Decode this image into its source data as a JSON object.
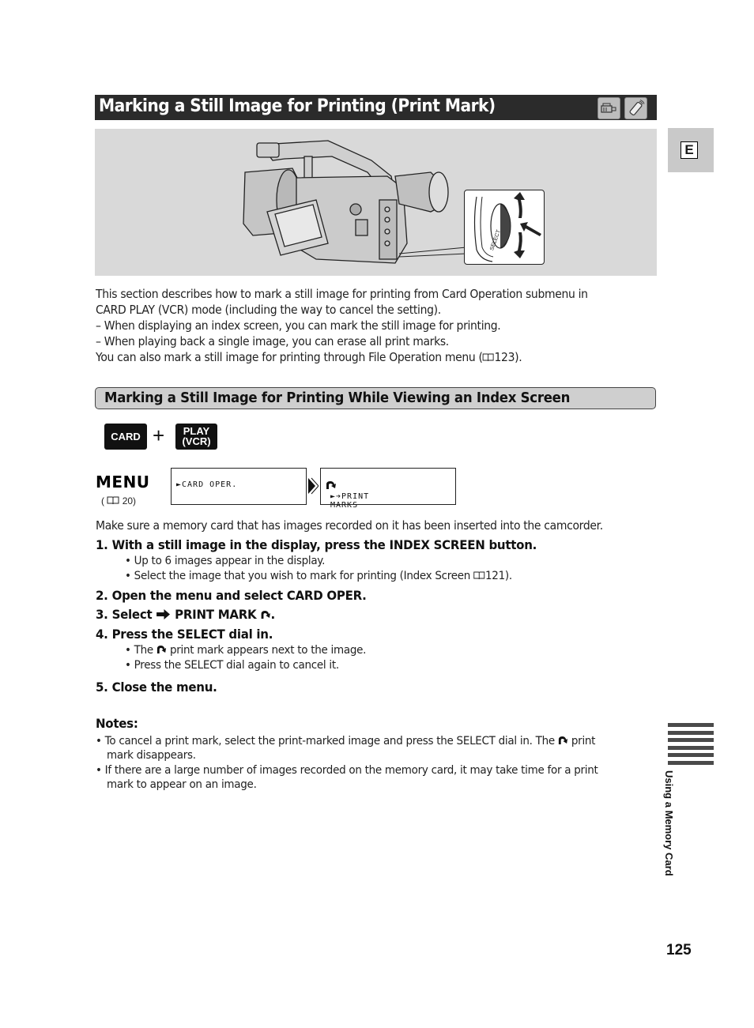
{
  "page": {
    "title": "Marking a Still Image for Printing (Print Mark)",
    "mode_icons": [
      "camcorder-icon",
      "remote-control-icon"
    ],
    "language_tab": "E",
    "illustration": {
      "main": "camcorder-illustration",
      "inset": "select-dial-illustration",
      "inset_label": "SELECT"
    },
    "intro": [
      "This section describes how to mark a still image for printing from Card Operation submenu in",
      "CARD PLAY (VCR) mode (including the way to cancel the setting).",
      "– When displaying an index screen, you can mark the still image for printing.",
      "– When playing back a single image, you can erase all print marks."
    ],
    "intro_ref": {
      "before": "You can also mark a still image for printing through File Operation menu (",
      "page": "123",
      "after": ")."
    },
    "subheading": "Marking a Still Image for Printing While Viewing an Index Screen",
    "mode": {
      "card_label": "CARD",
      "plus": "+",
      "play_line1": "PLAY",
      "play_line2": "(VCR)"
    },
    "menu": {
      "label": "MENU",
      "ref_open": "(",
      "ref_page": "20)",
      "screen1": "►CARD OPER.",
      "screen2": "►➔PRINT MARKS"
    },
    "prereq": "Make sure a memory card that has images recorded on it has been inserted into the camcorder.",
    "steps": [
      {
        "label": "1.  With a still image in the display, press the INDEX SCREEN button.",
        "bullets": [
          "• Up to 6 images appear in the display.",
          "• Select the image that you wish to mark for printing (Index Screen"
        ],
        "ref_page": "121)."
      },
      {
        "label": "2.  Open the menu and select CARD OPER."
      },
      {
        "label_a": "3.  Select",
        "label_b": "PRINT MARK",
        "label_c": "."
      },
      {
        "label": "4.  Press the SELECT dial in.",
        "bullets": [
          "print mark appears next to the image.",
          "• Press the SELECT dial again to cancel it."
        ],
        "bullet_prefix": "• The"
      },
      {
        "label": "5.  Close the menu."
      }
    ],
    "notes": {
      "heading": "Notes:",
      "items": [
        {
          "line1_a": "• To cancel a print mark, select the print-marked image and press the SELECT dial in. The",
          "line1_b": "print",
          "line2": "mark disappears."
        },
        {
          "line1": "• If there are a large number of images recorded on the memory card, it may take time for a print",
          "line2": "mark to appear on an image."
        }
      ]
    },
    "section_label": "Using a Memory Card",
    "page_number": "125"
  }
}
